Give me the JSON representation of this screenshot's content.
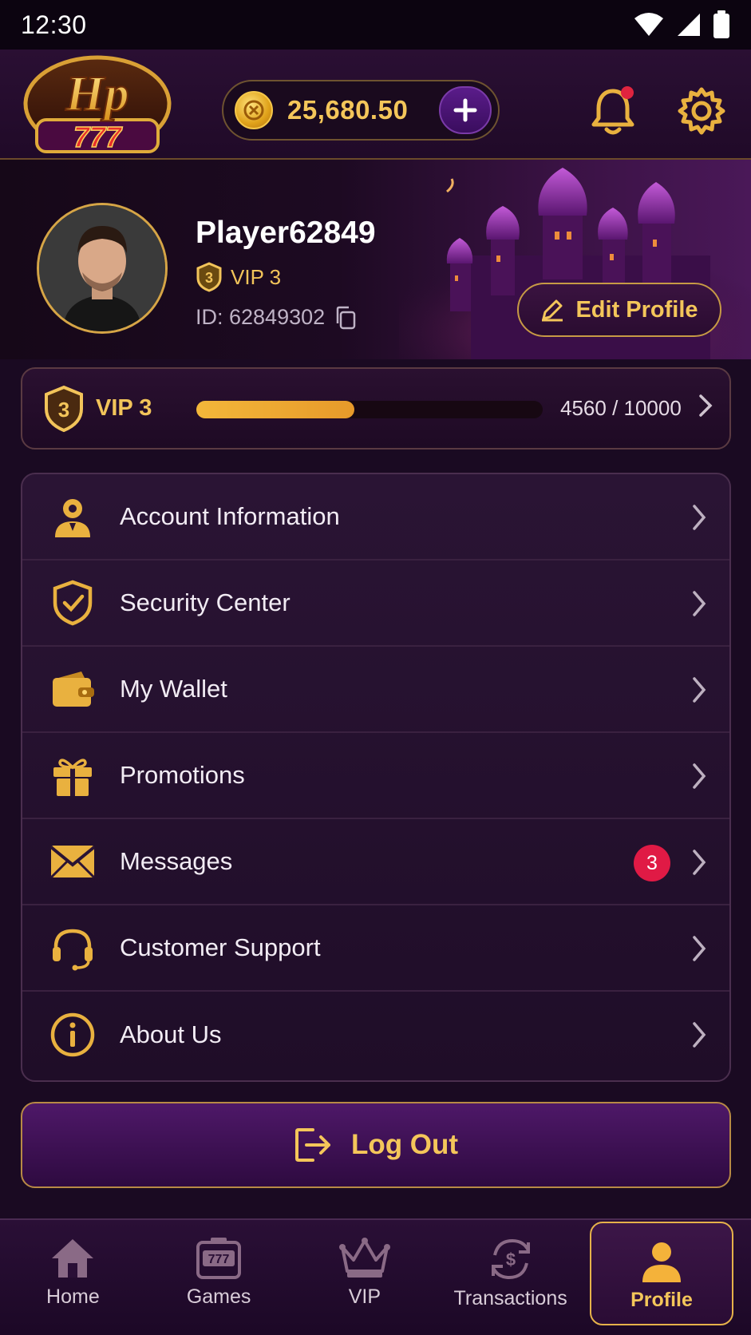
{
  "status_bar": {
    "time": "12:30"
  },
  "header": {
    "logo_text_top": "Hp",
    "logo_text_bottom": "777",
    "balance": "25,680.50",
    "add_funds_label": "+",
    "notification_dot": true
  },
  "profile": {
    "name": "Player62849",
    "vip_badge": "VIP 3",
    "vip_level_num": "3",
    "id_text": "ID: 62849302",
    "edit_label": "Edit Profile"
  },
  "vip_progress": {
    "label": "VIP 3",
    "level_num": "3",
    "progress_text": "4560 / 10000",
    "progress_fraction": 0.456
  },
  "menu": {
    "items": [
      {
        "label": "Account Information",
        "icon": "user-icon"
      },
      {
        "label": "Security Center",
        "icon": "shield-check-icon"
      },
      {
        "label": "My Wallet",
        "icon": "wallet-icon"
      },
      {
        "label": "Promotions",
        "icon": "gift-icon"
      },
      {
        "label": "Messages",
        "icon": "envelope-icon",
        "badge": "3"
      },
      {
        "label": "Customer Support",
        "icon": "headset-icon"
      },
      {
        "label": "About Us",
        "icon": "info-icon"
      }
    ]
  },
  "logout": {
    "label": "Log Out"
  },
  "tabbar": {
    "tabs": [
      {
        "label": "Home",
        "icon": "home-icon"
      },
      {
        "label": "Games",
        "icon": "slot-machine-icon"
      },
      {
        "label": "VIP",
        "icon": "crown-icon"
      },
      {
        "label": "Transactions",
        "icon": "dollar-cycle-icon"
      },
      {
        "label": "Profile",
        "icon": "profile-icon",
        "active": true
      }
    ]
  },
  "colors": {
    "gold": "#f4c65a",
    "accent_purple": "#4e1868",
    "badge_red": "#e01a45"
  }
}
